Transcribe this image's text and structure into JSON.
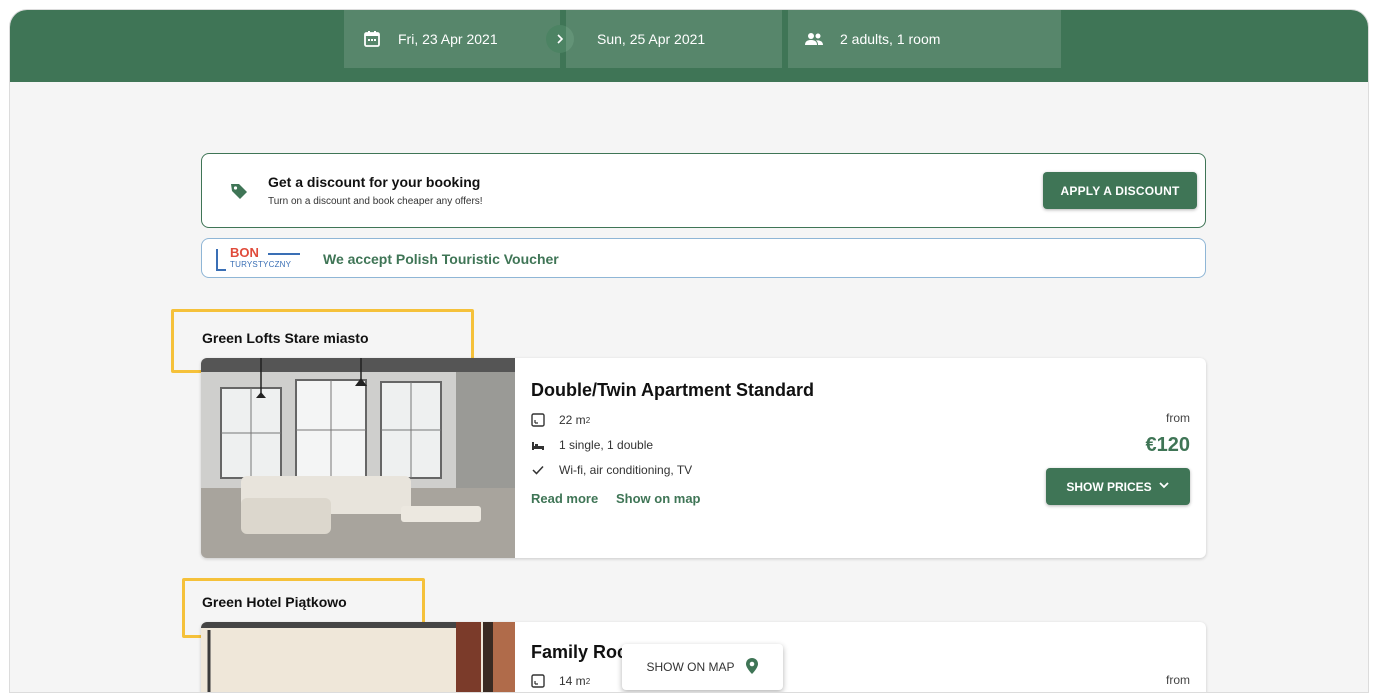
{
  "search": {
    "checkin": "Fri, 23 Apr 2021",
    "checkout": "Sun, 25 Apr 2021",
    "guests": "2 adults, 1 room"
  },
  "discount": {
    "title": "Get a discount for your booking",
    "subtitle": "Turn on a discount and book cheaper any offers!",
    "button": "APPLY A DISCOUNT"
  },
  "voucher": {
    "logo_top": "BON",
    "logo_bottom": "TURYSTYCZNY",
    "text": "We accept Polish Touristic Voucher"
  },
  "hotels": [
    {
      "name": "Green Lofts Stare miasto",
      "room": {
        "title": "Double/Twin Apartment Standard",
        "area_value": "22 m",
        "area_sup": "2",
        "beds": "1 single, 1 double",
        "amenities": "Wi-fi, air conditioning, TV",
        "read_more": "Read more",
        "show_on_map": "Show on map",
        "from": "from",
        "price": "€120",
        "button": "SHOW PRICES"
      }
    },
    {
      "name": "Green Hotel Piątkowo",
      "room": {
        "title": "Family Roc",
        "area_value": "14 m",
        "area_sup": "2",
        "from": "from"
      }
    }
  ],
  "floating": {
    "show_on_map": "SHOW ON MAP"
  },
  "colors": {
    "primary": "#3f7556",
    "highlight": "#f5c13a"
  }
}
